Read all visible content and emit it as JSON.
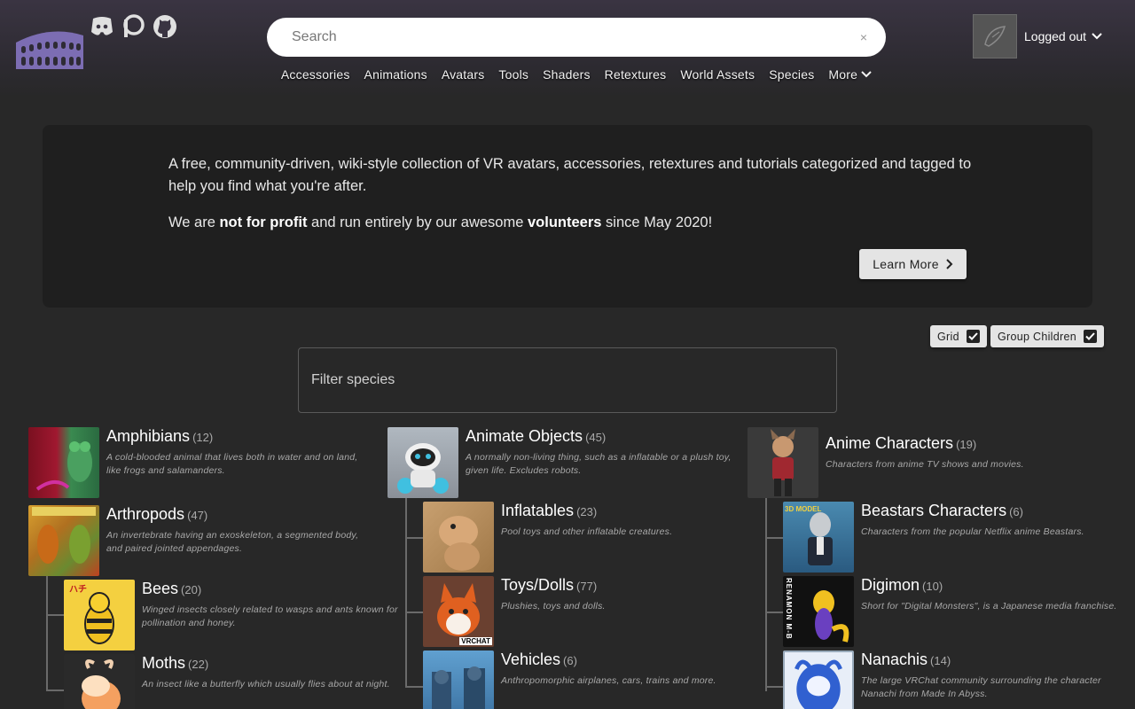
{
  "header": {
    "search_placeholder": "Search",
    "clear_glyph": "×",
    "nav": [
      "Accessories",
      "Animations",
      "Avatars",
      "Tools",
      "Shaders",
      "Retextures",
      "World Assets",
      "Species"
    ],
    "more_label": "More",
    "user_label": "Logged out",
    "icons": [
      "colosseum-logo-icon",
      "discord-icon",
      "patreon-icon",
      "github-icon"
    ]
  },
  "hero": {
    "line1": "A free, community-driven, wiki-style collection of VR avatars, accessories, retextures and tutorials categorized and tagged to help you find what you're after.",
    "line2_pre": "We are ",
    "line2_b1": "not for profit",
    "line2_mid": " and run entirely by our awesome ",
    "line2_b2": "volunteers",
    "line2_post": " since May 2020!",
    "button": "Learn More"
  },
  "toggles": {
    "grid": "Grid",
    "group_children": "Group Children",
    "grid_checked": true,
    "group_checked": true
  },
  "filter_placeholder": "Filter species",
  "species": {
    "amphibians": {
      "name": "Amphibians",
      "count": "(12)",
      "desc": "A cold-blooded animal that lives both in water and on land, like frogs and salamanders."
    },
    "arthropods": {
      "name": "Arthropods",
      "count": "(47)",
      "desc": "An invertebrate having an exoskeleton, a segmented body, and paired jointed appendages."
    },
    "bees": {
      "name": "Bees",
      "count": "(20)",
      "desc": "Winged insects closely related to wasps and ants known for pollination and honey."
    },
    "moths": {
      "name": "Moths",
      "count": "(22)",
      "desc": "An insect like a butterfly which usually flies about at night."
    },
    "animate": {
      "name": "Animate Objects",
      "count": "(45)",
      "desc": "A normally non-living thing, such as a inflatable or a plush toy, given life. Excludes robots."
    },
    "inflatables": {
      "name": "Inflatables",
      "count": "(23)",
      "desc": "Pool toys and other inflatable creatures."
    },
    "toys": {
      "name": "Toys/Dolls",
      "count": "(77)",
      "desc": "Plushies, toys and dolls."
    },
    "vehicles": {
      "name": "Vehicles",
      "count": "(6)",
      "desc": "Anthropomorphic airplanes, cars, trains and more."
    },
    "anime": {
      "name": "Anime Characters",
      "count": "(19)",
      "desc": "Characters from anime TV shows and movies."
    },
    "beastars": {
      "name": "Beastars Characters",
      "count": "(6)",
      "desc": "Characters from the popular Netflix anime Beastars."
    },
    "digimon": {
      "name": "Digimon",
      "count": "(10)",
      "desc": "Short for \"Digital Monsters\", is a Japanese media franchise."
    },
    "nanachis": {
      "name": "Nanachis",
      "count": "(14)",
      "desc": "The large VRChat community surrounding the character Nanachi from Made In Abyss."
    }
  },
  "thumb_badges": {
    "toys": "VRCHAT",
    "beastars": "3D MODEL",
    "digimon": "RENAMON M-B"
  },
  "colors": {
    "background": "#282828",
    "hero_bg": "#1f1f1f",
    "logo": "#8a7cc0"
  }
}
